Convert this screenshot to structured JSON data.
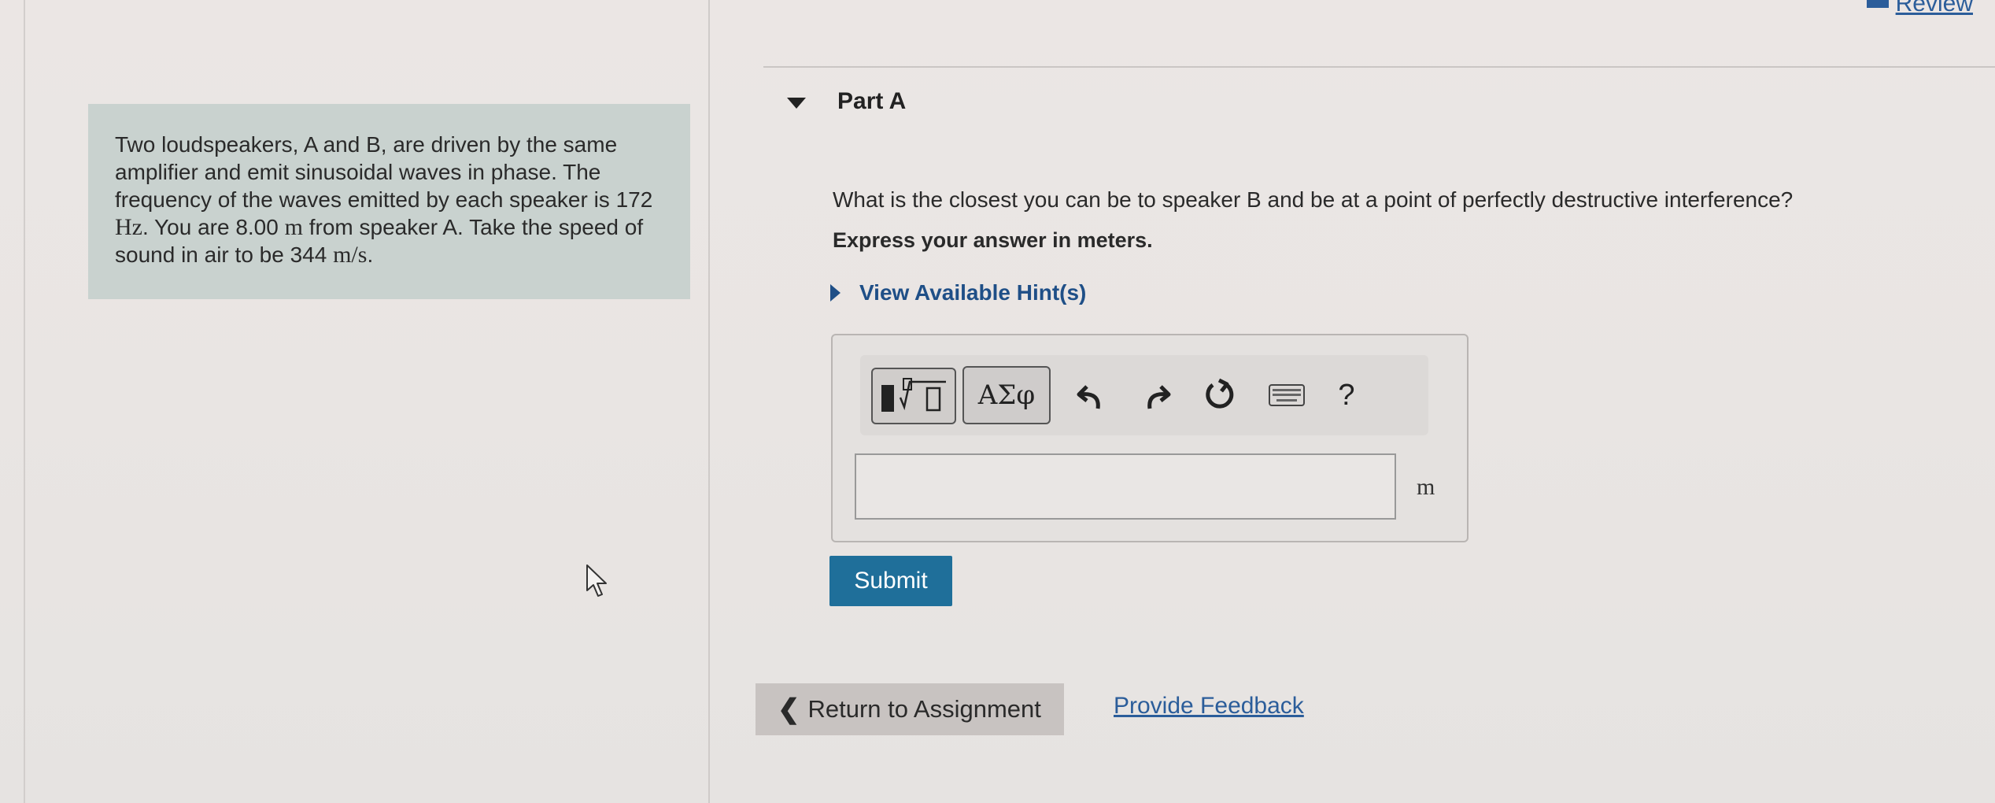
{
  "header": {
    "review_link": "Review"
  },
  "problem": {
    "text_parts": {
      "p1": "Two loudspeakers, A and B, are driven by the same amplifier and emit sinusoidal waves in phase. The frequency of the waves emitted by each speaker is ",
      "freq_value": "172 ",
      "freq_unit": "Hz",
      "p2": ". You are 8.00 ",
      "dist_unit": "m",
      "p3": " from speaker A. Take the speed of sound in air to be 344 ",
      "speed_unit": "m/s",
      "p4": "."
    }
  },
  "part": {
    "title": "Part A",
    "question": "What is the closest you can be to speaker B and be at a point of perfectly destructive interference?",
    "instruction": "Express your answer in meters.",
    "hint_label": "View Available Hint(s)"
  },
  "toolbar": {
    "greek_label": "ΑΣφ",
    "help_label": "?"
  },
  "answer": {
    "value": "",
    "unit": "m"
  },
  "buttons": {
    "submit_label": "Submit",
    "return_label": "Return to Assignment",
    "feedback_label": "Provide Feedback"
  },
  "colors": {
    "submit_bg": "#1f6f9a",
    "link": "#2b5d9a",
    "problem_bg": "#c9d2cf"
  }
}
